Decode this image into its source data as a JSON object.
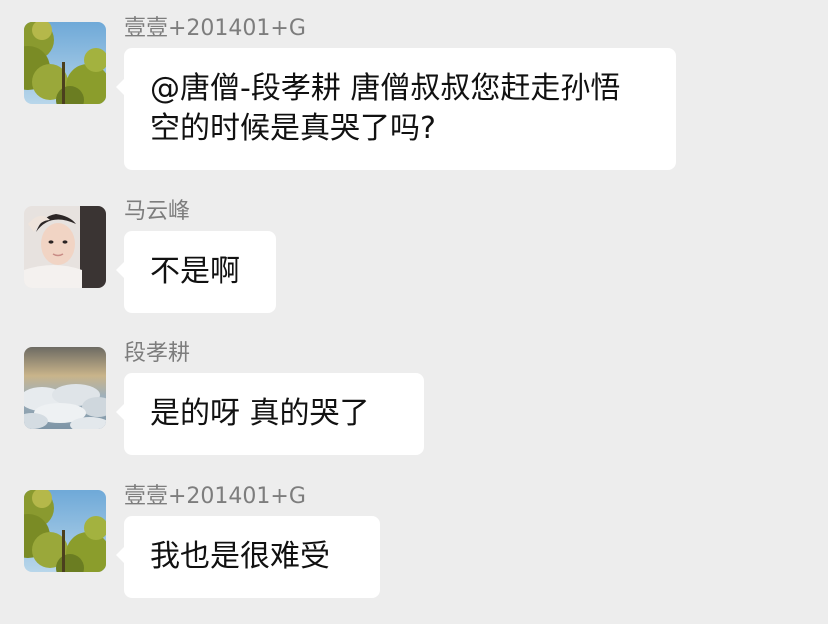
{
  "chat": {
    "messages": [
      {
        "sender": "壹壹+201401+G",
        "avatar_icon": "tree-sky-avatar-icon",
        "text": "@唐僧-段孝耕 唐僧叔叔您赶走孙悟空的时候是真哭了吗?"
      },
      {
        "sender": "马云峰",
        "avatar_icon": "person-portrait-avatar-icon",
        "text": "不是啊"
      },
      {
        "sender": "段孝耕",
        "avatar_icon": "clouds-avatar-icon",
        "text": "是的呀 真的哭了"
      },
      {
        "sender": "壹壹+201401+G",
        "avatar_icon": "tree-sky-avatar-icon",
        "text": "我也是很难受"
      }
    ]
  },
  "colors": {
    "background": "#ededed",
    "bubble": "#ffffff",
    "sender_name": "#7d7d7d",
    "message_text": "#111111"
  }
}
